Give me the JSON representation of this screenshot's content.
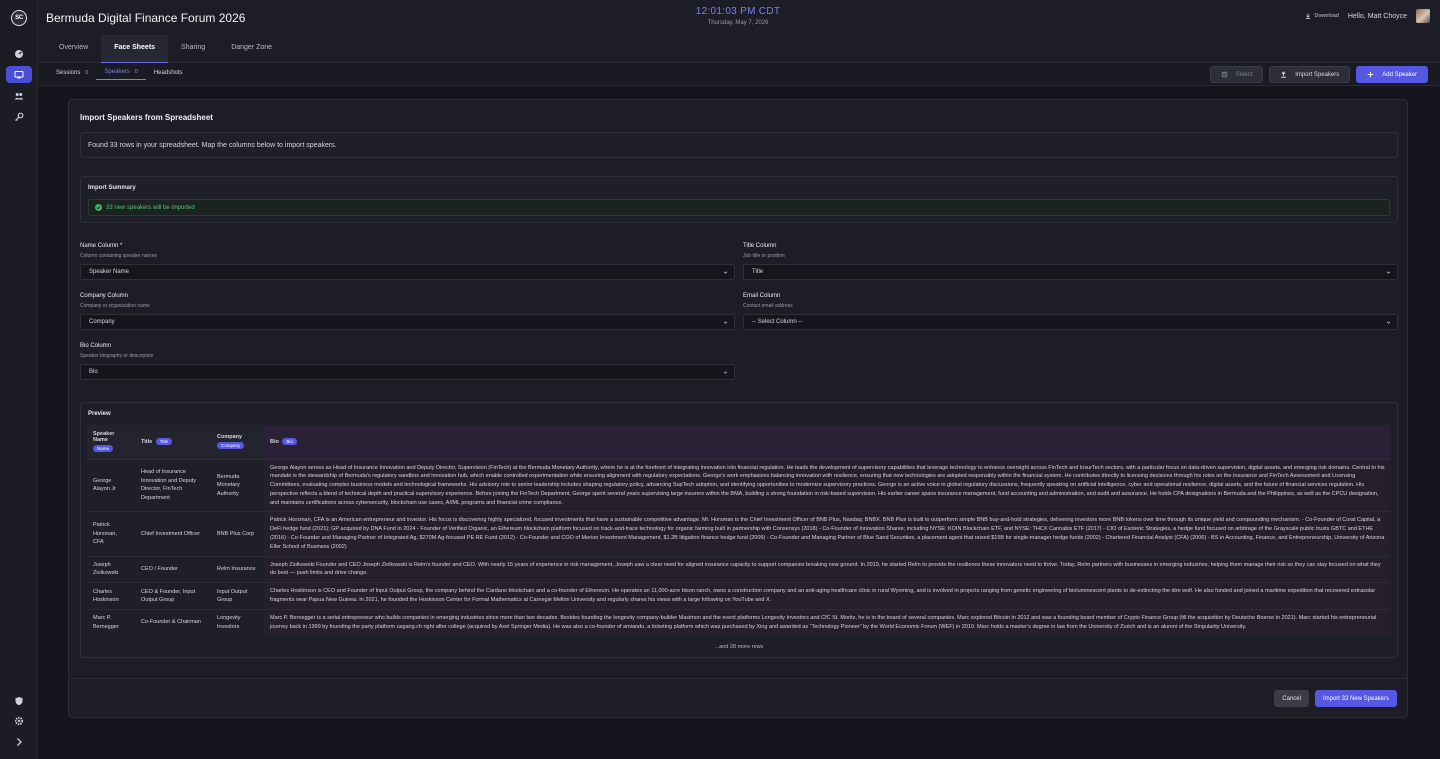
{
  "app": {
    "logo_text": "SC",
    "title": "Bermuda Digital Finance Forum 2026"
  },
  "clock": {
    "time": "12:01:03 PM CDT",
    "date": "Thursday, May 7, 2026"
  },
  "header": {
    "download_label": "Download",
    "greeting": "Hello, Matt Choyce"
  },
  "tabs": [
    {
      "label": "Overview"
    },
    {
      "label": "Face Sheets"
    },
    {
      "label": "Sharing"
    },
    {
      "label": "Danger Zone"
    }
  ],
  "subtabs": [
    {
      "label": "Sessions",
      "count": "0"
    },
    {
      "label": "Speakers",
      "count": "0"
    },
    {
      "label": "Headshots",
      "count": ""
    }
  ],
  "actions": {
    "select": "Select",
    "import": "Import Speakers",
    "add": "Add Speaker"
  },
  "import": {
    "title": "Import Speakers from Spreadsheet",
    "found_msg": "Found 33 rows in your spreadsheet. Map the columns below to import speakers.",
    "summary_title": "Import Summary",
    "summary_msg": "33 new speakers will be imported"
  },
  "fields": {
    "name": {
      "label": "Name Column *",
      "help": "Column containing speaker names",
      "value": "Speaker Name"
    },
    "title": {
      "label": "Title Column",
      "help": "Job title or position",
      "value": "Title"
    },
    "company": {
      "label": "Company Column",
      "help": "Company or organization name",
      "value": "Company"
    },
    "email": {
      "label": "Email Column",
      "help": "Contact email address",
      "value": "-- Select Column --"
    },
    "bio": {
      "label": "Bio Column",
      "help": "Speaker biography or description",
      "value": "Bio"
    }
  },
  "preview": {
    "title": "Preview",
    "headers": {
      "speaker_name": "Speaker Name",
      "name_chip": "Name",
      "title": "Title",
      "title_chip": "Title",
      "company": "Company",
      "company_chip": "Company",
      "bio": "Bio",
      "bio_chip": "Bio"
    },
    "rows": [
      {
        "name": "George Alayon Jr",
        "title": "Head of Insurance Innovation and Deputy Director, FinTech Department",
        "company": "Bermuda Monetary Authority",
        "bio": "George Alayon serves as Head of Insurance Innovation and Deputy Director, Supervision (FinTech) at the Bermuda Monetary Authority, where he is at the forefront of integrating innovation into financial regulation. He leads the development of supervisory capabilities that leverage technology to enhance oversight across FinTech and InsurTech sectors, with a particular focus on data-driven supervision, digital assets, and emerging risk domains. Central to his mandate is the stewardship of Bermuda's regulatory sandbox and innovation hub, which enable controlled experimentation while ensuring alignment with regulatory expectations. George's work emphasizes balancing innovation with resilience, ensuring that new technologies are adopted responsibly within the financial system. He contributes directly to licensing decisions through his roles on the Insurance and FinTech Assessment and Licensing Committees, evaluating complex business models and technological frameworks. His advisory role to senior leadership includes shaping regulatory policy, advancing SupTech adoption, and identifying opportunities to modernize supervisory practices. George is an active voice in global regulatory discussions, frequently speaking on artificial intelligence, cyber and operational resilience, digital assets, and the future of financial services regulation. His perspective reflects a blend of technical depth and practical supervisory experience. Before joining the FinTech Department, George spent several years supervising large insurers within the BMA, building a strong foundation in risk-based supervision. His earlier career spans insurance management, fund accounting and administration, and audit and assurance. He holds CPA designations in Bermuda and the Philippines, as well as the CPCU designation, and maintains certifications across cybersecurity, blockchain use cases, AI/ML programs and financial crime compliance."
      },
      {
        "name": "Patrick Horsman, CFA",
        "title": "Chief Investment Officer",
        "company": "BNB Plus Corp",
        "bio": "Patrick Horsman, CFA is an American entrepreneur and investor. His focus is discovering highly specialized, focused investments that have a sustainable competitive advantage. Mr. Horsman is the Chief Investment Officer of BNB Plus, Nasdaq: BNBX. BNB Plus is built to outperform simple BNB buy-and-hold strategies, delivering investors more BNB tokens over time through its unique yield and compounding mechanism. - Co-Founder of Coral Capital, a DeFi hedge fund (2021); GP acquired by DNA Fund in 2024 - Founder of Verified Organic, an Ethereum blockchain platform focused on track-and-trace technology for organic farming built in partnership with Consensys (2018) - Co-Founder of Innovation Shares; including NYSE: KOIN Blockchain ETF, and NYSE: THCX Cannabis ETF (2017) - CIO of Esoteric Strategies, a hedge fund focused on arbitrage of the Grayscale public trusts GBTC and ETHE (2016) - Co-Founder and Managing Partner of Integrated Ag, $270M Ag-focused PE RE Fund (2012) - Co-Founder and COO of Merion Investment Management, $1.2B litigation finance hedge fund (2009) - Co-Founder and Managing Partner of Blue Sand Securities, a placement agent that raised $15B for single-manager hedge funds (2002) - Chartered Financial Analyst (CFA) (2006) - BS in Accounting, Finance, and Entrepreneurship, University of Arizona Eller School of Business (2002)"
      },
      {
        "name": "Joseph Ziolkowski",
        "title": "CEO / Founder",
        "company": "Relm Insurance",
        "bio": "Joseph Ziolkowski Founder and CEO Joseph Ziolkowski is Relm's founder and CEO. With nearly 15 years of experience in risk management, Joseph saw a clear need for aligned insurance capacity to support companies breaking new ground. In 2019, he started Relm to provide the resilience these innovators need to thrive. Today, Relm partners with businesses in emerging industries, helping them manage their risk so they can stay focused on what they do best — push limits and drive change."
      },
      {
        "name": "Charles Hoskinson",
        "title": "CEO & Founder, Input Output Group",
        "company": "Input Output Group",
        "bio": "Charles Hoskinson is CEO and Founder of Input Output Group, the company behind the Cardano blockchain and a co-founder of Ethereum. He operates an 11,000-acre bison ranch, owns a construction company and an anti-aging healthcare clinic in rural Wyoming, and is involved in projects ranging from genetic engineering of bioluminescent plants to de-extincting the dire wolf. He also funded and joined a maritime expedition that recovered extrasolar fragments near Papua New Guinea. In 2021, he founded the Hoskinson Center for Formal Mathematics at Carnegie Mellon University and regularly shares his views with a large following on YouTube and X."
      },
      {
        "name": "Marc P. Bernegger",
        "title": "Co-Founder & Chairman",
        "company": "Longevity Investors",
        "bio": "Marc P. Bernegger is a serial entrepreneur who builds companies in emerging industries since more than two decades. Besides founding the longevity company-builder Maximon and the event platforms Longevity Investors and CfC St. Moritz, he is in the board of several companies. Marc explored Bitcoin in 2012 and was a founding board member of Crypto Finance Group (till the acquisition by Deutsche Boerse in 2021). Marc started his entrepreneurial journey back in 1999 by founding the party platform usgang.ch right after college (acquired by Axel Springer Media). He was also a co-founder of amiando, a ticketing platform which was purchased by Xing and awarded as “Technology Pioneer” by the World Economic Forum (WEF) in 2010. Marc holds a master’s degree in law from the University of Zurich and is an alumni of the Singularity University."
      }
    ],
    "more": "...and 28 more rows"
  },
  "footer": {
    "cancel": "Cancel",
    "import": "Import 33 New Speakers"
  },
  "colors": {
    "accent": "#5558e3",
    "clock": "#7c7ff5",
    "success": "#4fc07a"
  }
}
